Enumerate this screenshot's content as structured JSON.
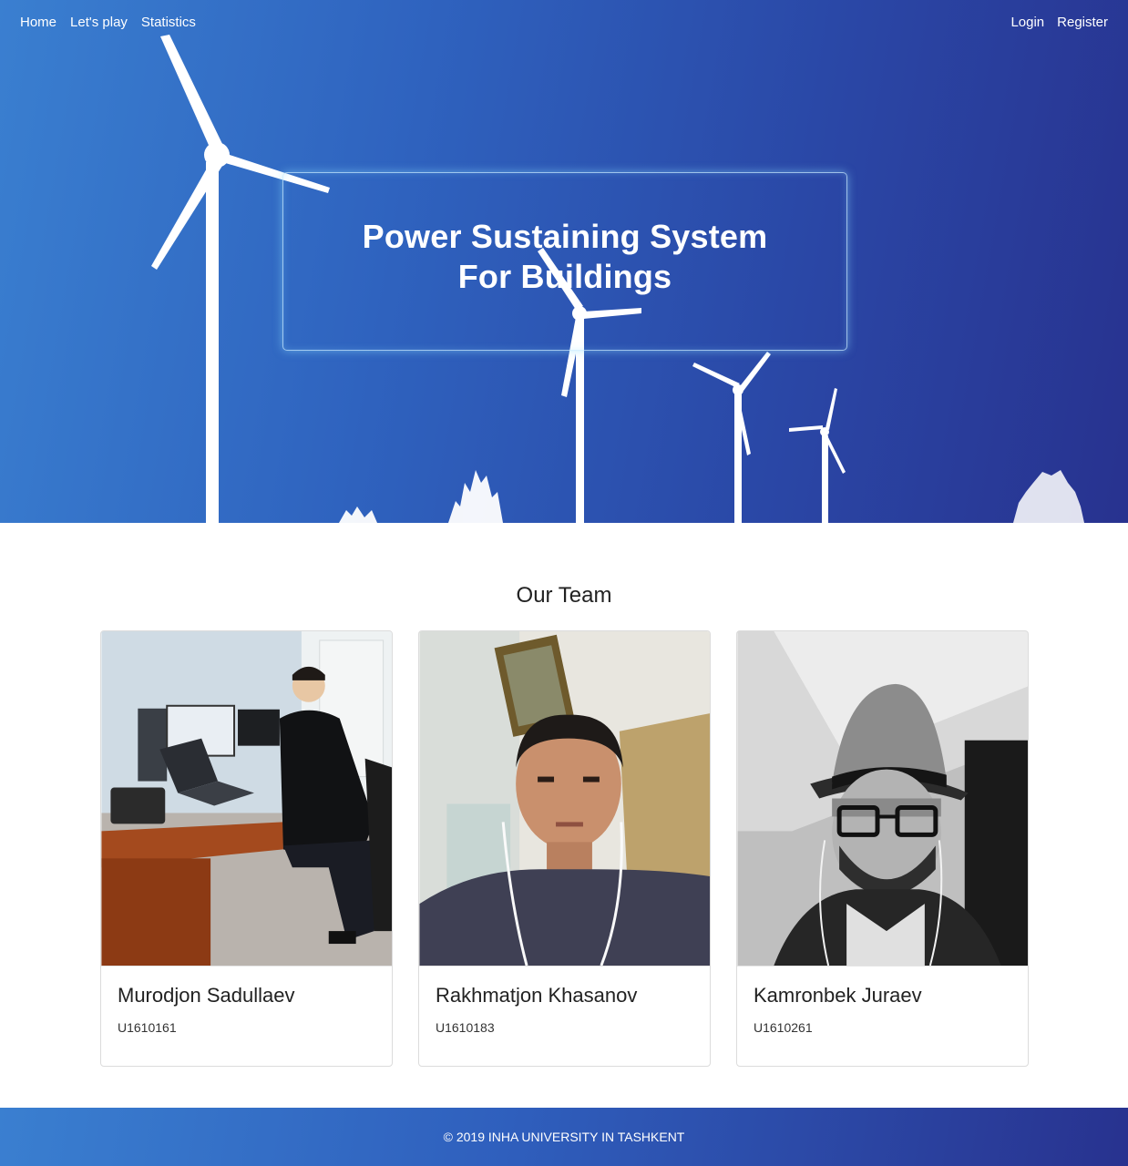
{
  "nav": {
    "left": [
      {
        "label": "Home"
      },
      {
        "label": "Let's play"
      },
      {
        "label": "Statistics"
      }
    ],
    "right": [
      {
        "label": "Login"
      },
      {
        "label": "Register"
      }
    ]
  },
  "hero": {
    "title": "Power Sustaining System For Buildings",
    "background_icon": "wind-turbines-illustration"
  },
  "team": {
    "heading": "Our Team",
    "members": [
      {
        "name": "Murodjon Sadullaev",
        "id": "U1610161",
        "photo_icon": "person-at-desk-photo"
      },
      {
        "name": "Rakhmatjon Khasanov",
        "id": "U1610183",
        "photo_icon": "selfie-photo"
      },
      {
        "name": "Kamronbek Juraev",
        "id": "U1610261",
        "photo_icon": "hat-portrait-photo"
      }
    ]
  },
  "footer": {
    "text": "© 2019 INHA UNIVERSITY IN TASHKENT"
  },
  "colors": {
    "hero_start": "#3a7fd0",
    "hero_end": "#28328f",
    "text_dark": "#222222"
  }
}
